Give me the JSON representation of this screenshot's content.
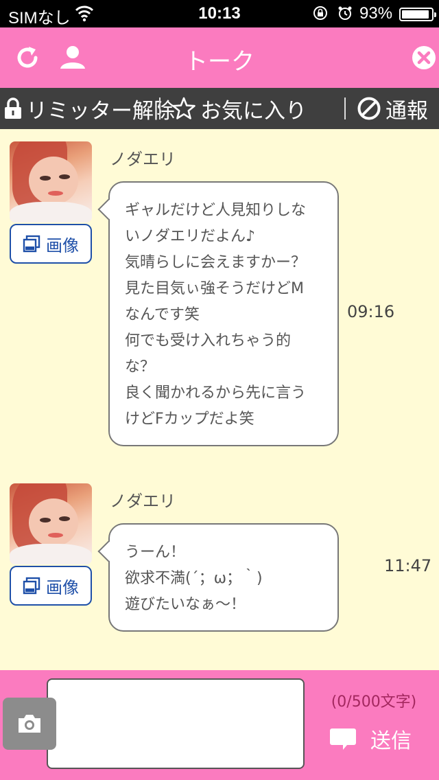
{
  "status_bar": {
    "carrier": "SIMなし",
    "time": "10:13",
    "battery_percent": "93%",
    "battery_level": 0.93
  },
  "header": {
    "title": "トーク",
    "icons": [
      "refresh-icon",
      "profile-icon",
      "close-icon"
    ]
  },
  "toolbar": {
    "limiter_label": "リミッター解除",
    "favorite_label": "お気に入り",
    "report_label": "通報"
  },
  "messages": [
    {
      "sender": "ノダエリ",
      "image_button_label": "画像",
      "lines": [
        "ギャルだけど人見知りしな",
        "いノダエリだよん♪",
        "気晴らしに会えますかー？",
        "見た目気ぃ強そうだけどM",
        "なんです笑",
        "何でも受け入れちゃう的",
        "な？",
        "良く聞かれるから先に言う",
        "けどFカップだよ笑"
      ],
      "time": "09:16"
    },
    {
      "sender": "ノダエリ",
      "image_button_label": "画像",
      "lines": [
        "うーん！",
        "欲求不満(´；ω；｀)",
        "遊びたいなぁ〜！"
      ],
      "time": "11:47"
    }
  ],
  "composer": {
    "value": "",
    "counter": "(0/500文字)",
    "send_label": "送信"
  },
  "colors": {
    "pink": "#fb7bbf",
    "background": "#fffbd6",
    "toolbar": "#3f3f3f",
    "link_blue": "#1e4fa8"
  }
}
